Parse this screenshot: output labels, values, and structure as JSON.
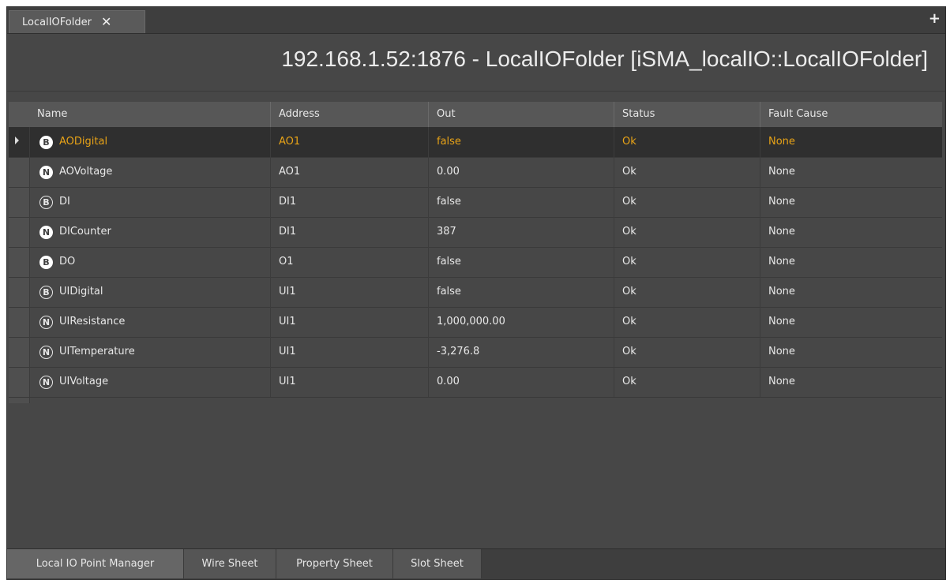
{
  "top_tab": {
    "label": "LocalIOFolder",
    "close_glyph": "✕"
  },
  "plus_glyph": "+",
  "header": {
    "title": "192.168.1.52:1876 - LocalIOFolder [iSMA_localIO::LocalIOFolder]"
  },
  "table": {
    "columns": [
      "Name",
      "Address",
      "Out",
      "Status",
      "Fault Cause"
    ],
    "rows": [
      {
        "badge": "B",
        "badge_style": "filled",
        "name": "AODigital",
        "address": "AO1",
        "out": "false",
        "status": "Ok",
        "fault": "None"
      },
      {
        "badge": "N",
        "badge_style": "filled",
        "name": "AOVoltage",
        "address": "AO1",
        "out": "0.00",
        "status": "Ok",
        "fault": "None"
      },
      {
        "badge": "B",
        "badge_style": "outline",
        "name": "DI",
        "address": "DI1",
        "out": "false",
        "status": "Ok",
        "fault": "None"
      },
      {
        "badge": "N",
        "badge_style": "filled",
        "name": "DICounter",
        "address": "DI1",
        "out": "387",
        "status": "Ok",
        "fault": "None"
      },
      {
        "badge": "B",
        "badge_style": "filled",
        "name": "DO",
        "address": "O1",
        "out": "false",
        "status": "Ok",
        "fault": "None"
      },
      {
        "badge": "B",
        "badge_style": "outline",
        "name": "UIDigital",
        "address": "UI1",
        "out": "false",
        "status": "Ok",
        "fault": "None"
      },
      {
        "badge": "N",
        "badge_style": "outline",
        "name": "UIResistance",
        "address": "UI1",
        "out": "1,000,000.00",
        "status": "Ok",
        "fault": "None"
      },
      {
        "badge": "N",
        "badge_style": "outline",
        "name": "UITemperature",
        "address": "UI1",
        "out": "-3,276.8",
        "status": "Ok",
        "fault": "None"
      },
      {
        "badge": "N",
        "badge_style": "outline",
        "name": "UIVoltage",
        "address": "UI1",
        "out": "0.00",
        "status": "Ok",
        "fault": "None"
      }
    ],
    "selected_index": 0
  },
  "bottom_tabs": [
    {
      "label": "Local IO Point Manager",
      "active": true
    },
    {
      "label": "Wire Sheet",
      "active": false
    },
    {
      "label": "Property Sheet",
      "active": false
    },
    {
      "label": "Slot Sheet",
      "active": false
    }
  ],
  "colors": {
    "background": "#474747",
    "selected_text": "#e8a317",
    "text": "#e8e8e8"
  }
}
